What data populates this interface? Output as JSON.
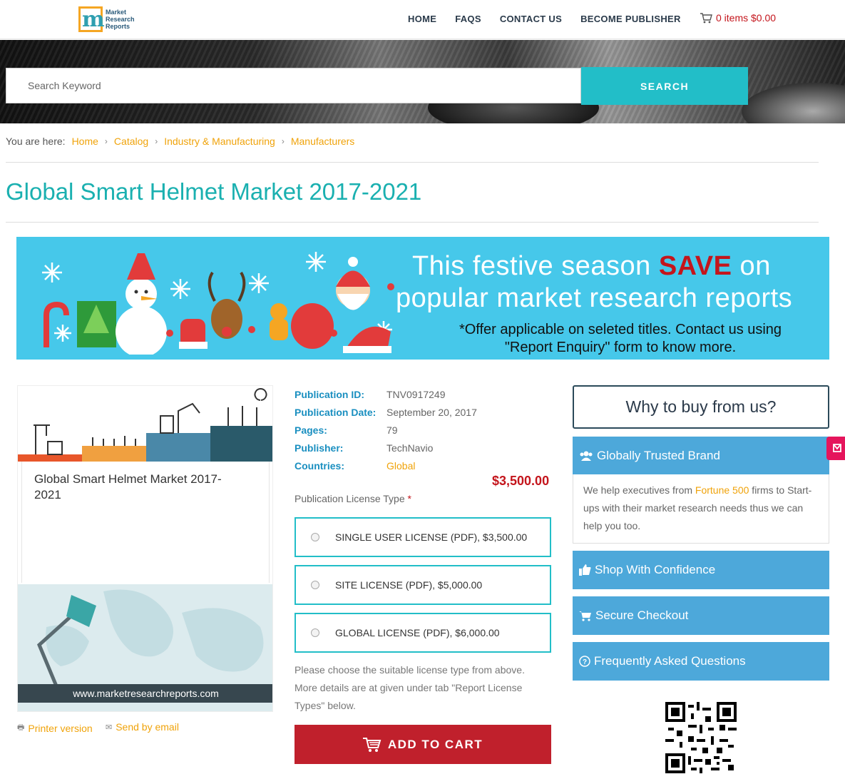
{
  "header": {
    "logo_text": [
      "Market",
      "Research",
      "Reports"
    ],
    "nav": [
      "HOME",
      "FAQS",
      "CONTACT US",
      "BECOME PUBLISHER"
    ],
    "cart_text": "0 items $0.00"
  },
  "search": {
    "placeholder": "Search Keyword",
    "button_label": "SEARCH"
  },
  "breadcrumb": {
    "prefix": "You are here:",
    "items": [
      "Home",
      "Catalog",
      "Industry & Manufacturing",
      "Manufacturers"
    ]
  },
  "page_title": "Global Smart Helmet Market 2017-2021",
  "promo": {
    "line1_a": "This festive season ",
    "line1_save": "SAVE",
    "line1_b": " on",
    "line2": "popular market research reports",
    "note_line1": "*Offer applicable on seleted titles. Contact us using",
    "note_line2": "\"Report Enquiry\" form to know more."
  },
  "product_image": {
    "title": "Global Smart Helmet Market 2017-2021",
    "url": "www.marketresearchreports.com"
  },
  "links": {
    "printer": "Printer version",
    "email": "Send by email"
  },
  "details": {
    "rows": [
      {
        "label": "Publication ID:",
        "value": "TNV0917249"
      },
      {
        "label": "Publication Date:",
        "value": "September 20, 2017"
      },
      {
        "label": "Pages:",
        "value": "79"
      },
      {
        "label": "Publisher:",
        "value": "TechNavio"
      },
      {
        "label": "Countries:",
        "value": "Global"
      }
    ],
    "price": "$3,500.00",
    "license_type_label": "Publication License Type",
    "required_mark": "*",
    "licenses": [
      "SINGLE USER LICENSE (PDF), $3,500.00",
      "SITE LICENSE (PDF), $5,000.00",
      "GLOBAL LICENSE (PDF), $6,000.00"
    ],
    "help_text": "Please choose the suitable license type from above. More details are at given under tab \"Report License Types\" below.",
    "add_to_cart": "ADD TO CART"
  },
  "why_buy": {
    "title": "Why to buy from us?",
    "panels": [
      {
        "title": "Globally Trusted Brand",
        "icon": "users-icon"
      },
      {
        "title": "Shop With Confidence",
        "icon": "thumbs-up-icon"
      },
      {
        "title": "Secure Checkout",
        "icon": "cart-icon"
      },
      {
        "title": "Frequently Asked Questions",
        "icon": "question-icon"
      }
    ],
    "trusted_text_a": "We help executives from ",
    "trusted_text_hl": "Fortune 500",
    "trusted_text_b": " firms to Start-ups with their market research needs thus we can help you too."
  },
  "colors": {
    "accent": "#22bec8",
    "title": "#1ab0b0",
    "link": "#f0a30a",
    "price": "#c4151c",
    "panel": "#4da8da",
    "cart_button": "#c0202c",
    "promo_bg": "#46c8ea"
  }
}
